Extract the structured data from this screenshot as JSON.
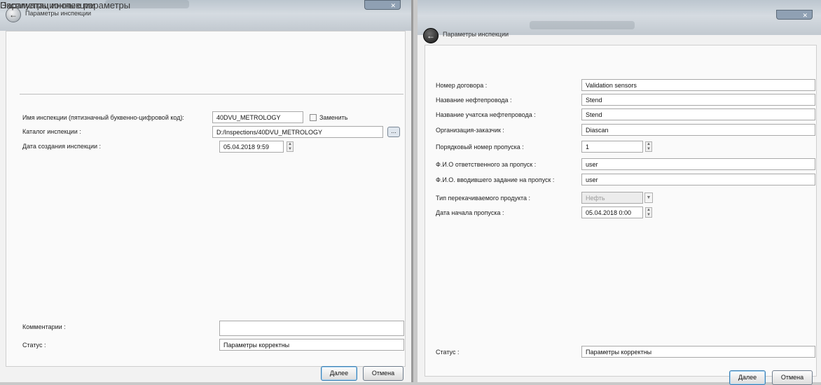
{
  "left_window": {
    "title": "Параметры инспекции",
    "section_title": "Параметры инспекции",
    "fields": {
      "inspection_name": {
        "label": "Имя инспекции (пятизначный буквенно-цифровой код):",
        "value": "40DVU_METROLOGY",
        "replace_label": "Заменить"
      },
      "inspection_catalog": {
        "label": "Каталог инспекции :",
        "value": "D:/Inspections/40DVU_METROLOGY",
        "browse_label": "..."
      },
      "creation_date": {
        "label": "Дата создания инспекции :",
        "value": "05.04.2018 9:59"
      },
      "comments": {
        "label": "Комментарии :",
        "value": ""
      },
      "status": {
        "label": "Статус :",
        "value": "Параметры корректны"
      }
    },
    "buttons": {
      "next": "Далее",
      "cancel": "Отмена"
    }
  },
  "right_window": {
    "title": "Параметры инспекции",
    "section_title": "Эксплуатационные параметры",
    "fields": [
      {
        "label": "Номер договора :",
        "value": "Validation sensors"
      },
      {
        "label": "Название нефтепровода :",
        "value": "Stend"
      },
      {
        "label": "Название учатска нефтепровода :",
        "value": "Stend"
      },
      {
        "label": "Организация-заказчик :",
        "value": "Diascan"
      },
      {
        "label": "Порядковый номер пропуска :",
        "value": "1"
      },
      {
        "label": "Ф.И.О ответственного за пропуск :",
        "value": "user"
      },
      {
        "label": "Ф.И.О. вводившего задание на пропуск :",
        "value": "user"
      },
      {
        "label": "Тип перекачиваемого продукта :",
        "value": "Нефть"
      },
      {
        "label": "Дата начала пропуска :",
        "value": "05.04.2018 0:00"
      }
    ],
    "status": {
      "label": "Статус :",
      "value": "Параметры корректны"
    },
    "buttons": {
      "next": "Далее",
      "cancel": "Отмена"
    }
  },
  "icons": {
    "back": "back-arrow-icon",
    "spinner": "spinner-arrows-icon",
    "dropdown": "chevron-down-icon",
    "checkbox": "checkbox-icon"
  }
}
